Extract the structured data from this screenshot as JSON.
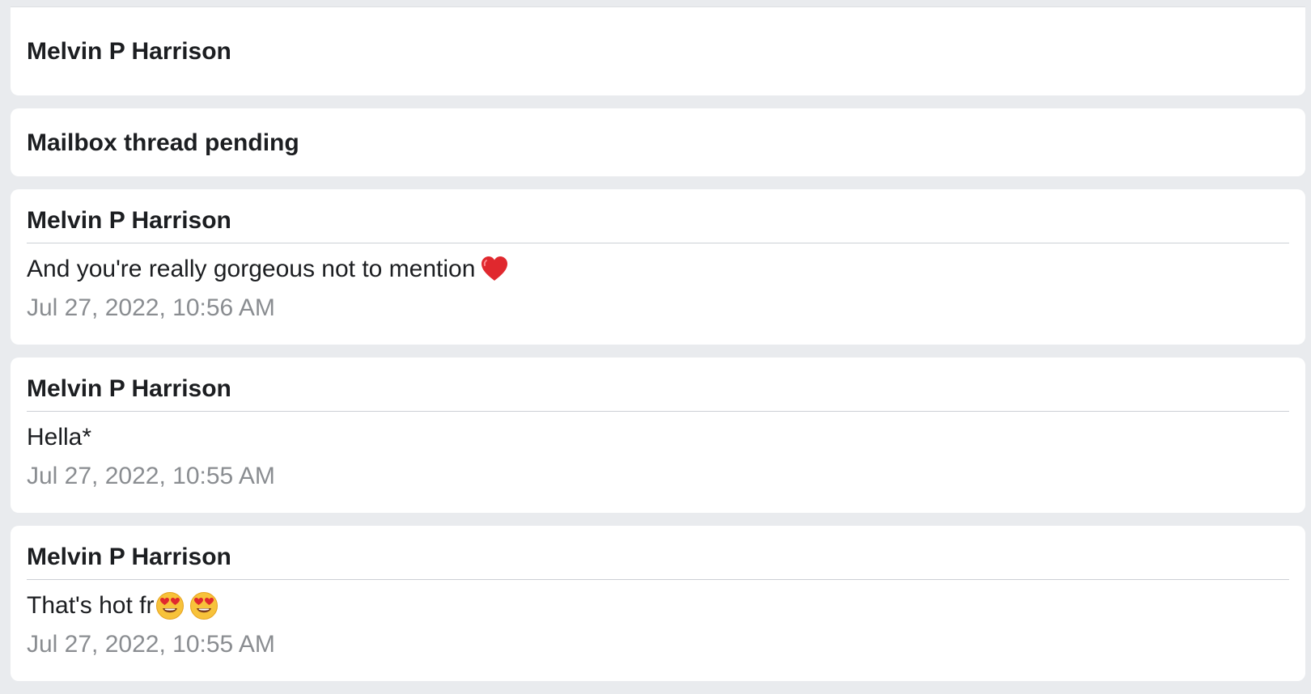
{
  "thread": {
    "header_name": "Melvin P Harrison",
    "status_label": "Mailbox thread pending",
    "messages": [
      {
        "sender": "Melvin P Harrison",
        "text": "And you're really gorgeous not to mention",
        "emojis": [
          "red-heart-emoji"
        ],
        "timestamp": "Jul 27, 2022, 10:56 AM"
      },
      {
        "sender": "Melvin P Harrison",
        "text": "Hella*",
        "emojis": [],
        "timestamp": "Jul 27, 2022, 10:55 AM"
      },
      {
        "sender": "Melvin P Harrison",
        "text": "That's hot fr",
        "emojis": [
          "heart-eyes-emoji",
          "heart-eyes-emoji"
        ],
        "timestamp": "Jul 27, 2022, 10:55 AM"
      }
    ]
  },
  "colors": {
    "background": "#e9ebee",
    "card": "#ffffff",
    "text": "#1c1e21",
    "timestamp": "#8a8d91",
    "divider": "#ccd0d5"
  }
}
